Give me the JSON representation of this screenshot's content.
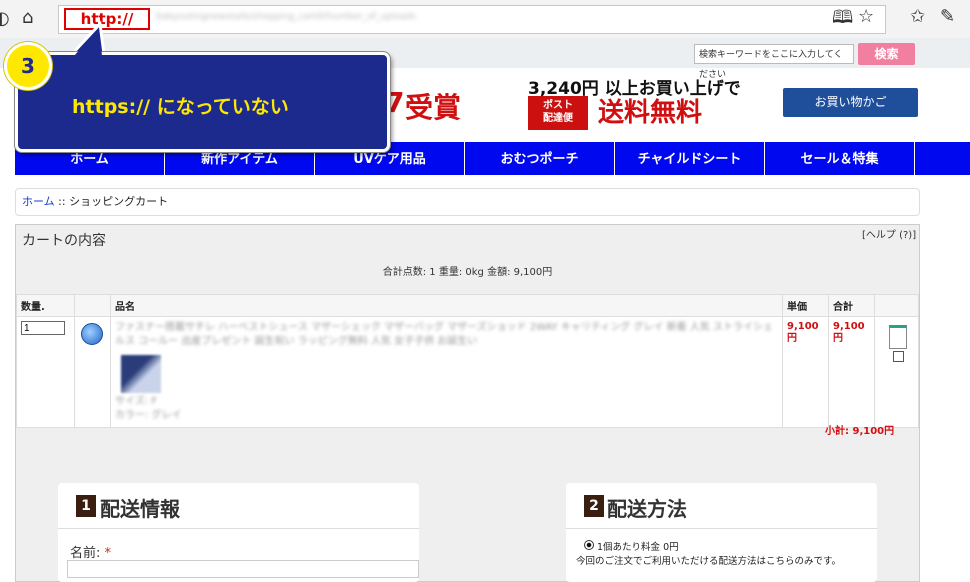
{
  "browser": {
    "url_scheme": "http://",
    "url_rest": "babyoutingnewstaile/shopping_cart/kfnumber_of_uploads",
    "icons": [
      "home-icon",
      "reading-view-icon",
      "favorite-star-icon",
      "favorites-list-icon",
      "pen-icon"
    ]
  },
  "callout": {
    "number": "3",
    "text": "https:// になっていない"
  },
  "header": {
    "search_placeholder": "検索キーワードをここに入力してください",
    "search_button": "検索",
    "award_text": "受賞",
    "award_slash": "7",
    "shipping_top": "3,240円 以上お買い上げで",
    "shipping_badge": "ポスト\n配達便",
    "shipping_free": "送料無料",
    "cart_button": "お買い物かご"
  },
  "nav": {
    "items": [
      "ホーム",
      "新作アイテム",
      "UVケア用品",
      "おむつポーチ",
      "チャイルドシート",
      "セール＆特集"
    ]
  },
  "breadcrumb": {
    "home": "ホーム",
    "separator": " :: ",
    "current": "ショッピングカート"
  },
  "cart": {
    "title": "カートの内容",
    "help": "[ヘルプ (?)]",
    "summary": "合計点数: 1  重量: 0kg  金額: 9,100円",
    "columns": {
      "qty": "数量.",
      "icon": "",
      "name": "品名",
      "unit_price": "単価",
      "total": "合計",
      "remove": ""
    },
    "items": [
      {
        "qty": "1",
        "name": "ファスナー搭載サチレ ハーベストシュース マザーシェック マザーバッグ マザーズショッド 2WAY キャリティング グレイ 新着 人気 ストライシェルス コールー 出産プレゼント 誕生祝い ラッピング無料 人気 女子子供 お誕生い",
        "option1": "サイズ: F",
        "option2": "カラー: グレイ",
        "unit_price": "9,100\n円",
        "total": "9,100\n円"
      }
    ],
    "subtotal": "小計: 9,100円"
  },
  "sections": {
    "shipping_info": {
      "number": "1",
      "title": "配送情報",
      "name_label": "名前:",
      "required_mark": "*"
    },
    "shipping_method": {
      "number": "2",
      "title": "配送方法",
      "option": "1個あたり料金  0円",
      "note": "今回のご注文でご利用いただける配送方法はこちらのみです。"
    }
  }
}
